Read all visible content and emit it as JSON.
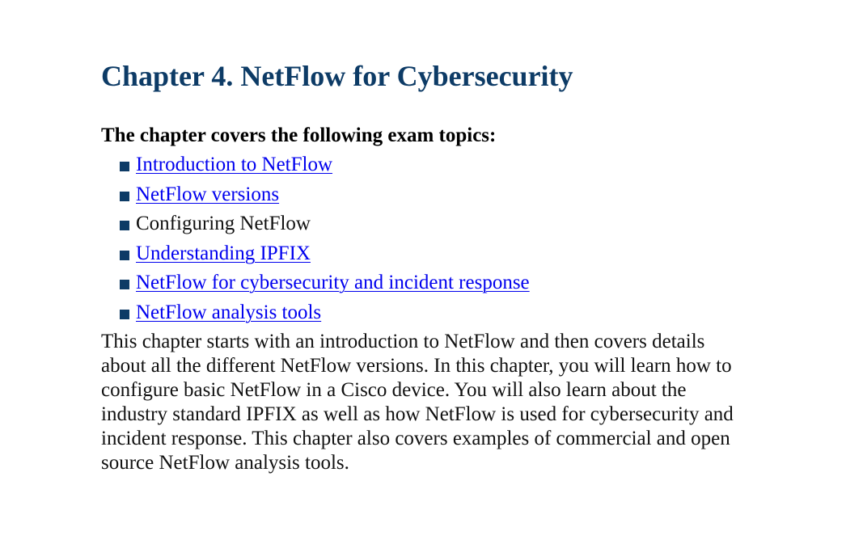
{
  "chapter": {
    "title": "Chapter 4. NetFlow for Cybersecurity"
  },
  "topics": {
    "heading": "The chapter covers the following exam topics:",
    "items": [
      {
        "label": "Introduction to NetFlow",
        "link": true
      },
      {
        "label": "NetFlow versions",
        "link": true
      },
      {
        "label": "Configuring NetFlow",
        "link": false
      },
      {
        "label": "Understanding IPFIX",
        "link": true
      },
      {
        "label": "NetFlow for cybersecurity and incident response",
        "link": true
      },
      {
        "label": "NetFlow analysis tools",
        "link": true
      }
    ]
  },
  "intro": {
    "text": "This chapter starts with an introduction to NetFlow and then covers details about all the different NetFlow versions. In this chapter, you will learn how to configure basic NetFlow in a Cisco device. You will also learn about the industry standard IPFIX as well as how NetFlow is used for cybersecurity and incident response. This chapter also covers examples of commercial and open source NetFlow analysis tools."
  },
  "colors": {
    "title": "#0d3b66",
    "bullet": "#0d3b66",
    "link": "#0000ee",
    "text": "#111111"
  },
  "icons": {
    "bullet": "square-bullet-icon"
  }
}
